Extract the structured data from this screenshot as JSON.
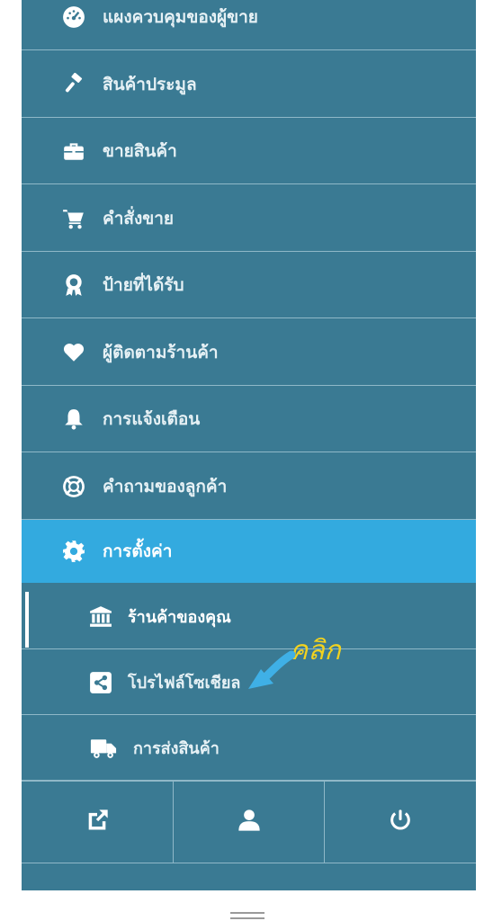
{
  "menu": {
    "items": [
      {
        "label": "แผงควบคุมของผู้ขาย",
        "icon": "dashboard-icon"
      },
      {
        "label": "สินค้าประมูล",
        "icon": "gavel-icon"
      },
      {
        "label": "ขายสินค้า",
        "icon": "briefcase-icon"
      },
      {
        "label": "คำสั่งขาย",
        "icon": "cart-icon"
      },
      {
        "label": "ป้ายที่ได้รับ",
        "icon": "award-icon"
      },
      {
        "label": "ผู้ติดตามร้านค้า",
        "icon": "heart-icon"
      },
      {
        "label": "การแจ้งเตือน",
        "icon": "bell-icon"
      },
      {
        "label": "คำถามของลูกค้า",
        "icon": "lifebuoy-icon"
      },
      {
        "label": "การตั้งค่า",
        "icon": "gear-icon"
      }
    ],
    "sub_items": [
      {
        "label": "ร้านค้าของคุณ",
        "icon": "bank-icon"
      },
      {
        "label": "โปรไฟล์โซเชียล",
        "icon": "share-icon"
      },
      {
        "label": "การส่งสินค้า",
        "icon": "truck-icon"
      }
    ]
  },
  "footer": {
    "buttons": [
      {
        "icon": "external-link-icon"
      },
      {
        "icon": "user-icon"
      },
      {
        "icon": "power-icon"
      }
    ]
  },
  "annotation": {
    "text": "คลิก",
    "color": "#f2d21f",
    "arrow_color": "#3fb0e6"
  },
  "colors": {
    "sidebar": "#3a7a93",
    "active": "#33aadf"
  }
}
